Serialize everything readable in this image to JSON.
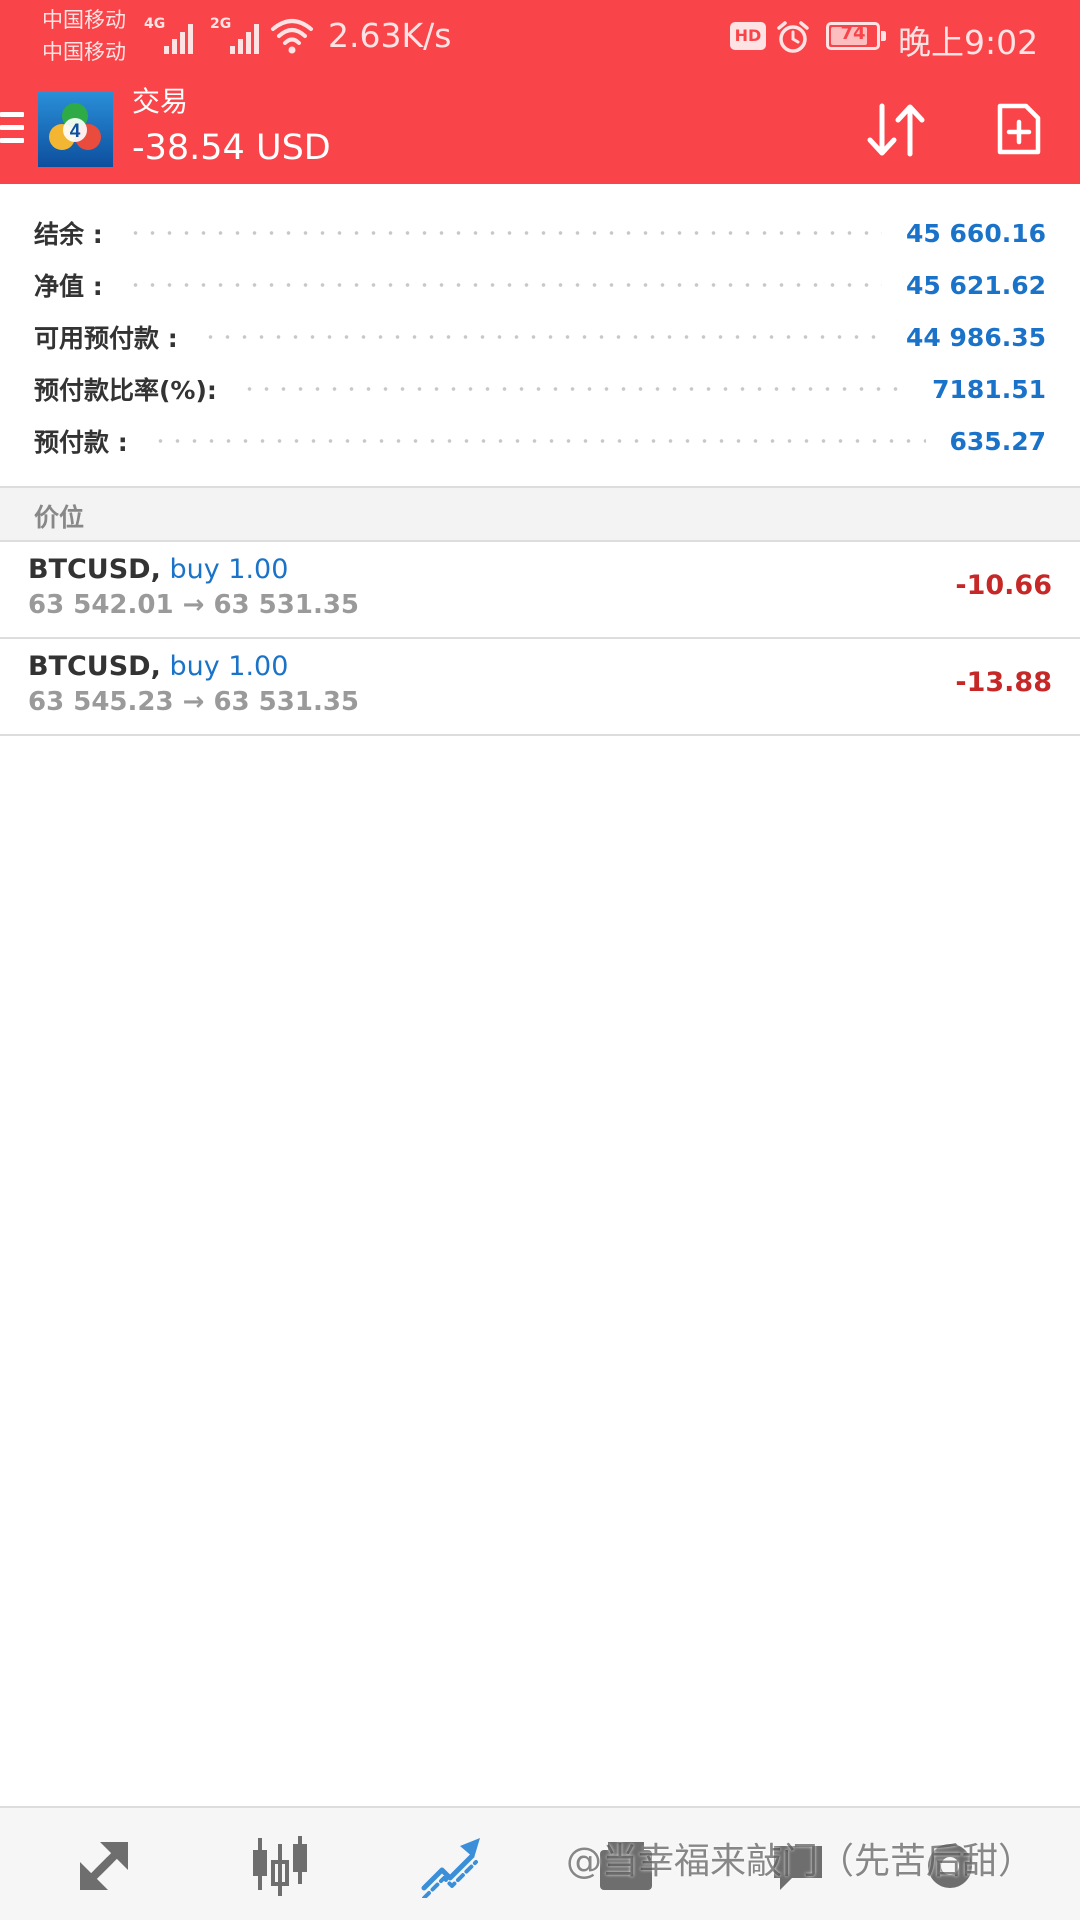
{
  "status_bar": {
    "carrier_1": "中国移动",
    "carrier_2": "中国移动",
    "signal_1_tag": "4G",
    "signal_2_tag": "2G",
    "net_speed": "2.63K/s",
    "hd_badge": "HD",
    "battery_level": "74",
    "time": "晚上9:02"
  },
  "app_bar": {
    "title": "交易",
    "subtitle": "-38.54 USD",
    "logo_icon": "metatrader-logo-icon",
    "sort_icon": "sort-arrows-icon",
    "new_order_icon": "new-document-icon",
    "menu_icon": "hamburger-menu-icon"
  },
  "summary": [
    {
      "label": "结余 :",
      "value": "45 660.16"
    },
    {
      "label": "净值 :",
      "value": "45 621.62"
    },
    {
      "label": "可用预付款 :",
      "value": "44 986.35"
    },
    {
      "label": "预付款比率(%):",
      "value": "7181.51"
    },
    {
      "label": "预付款 :",
      "value": "635.27"
    }
  ],
  "section": {
    "label": "价位"
  },
  "positions": [
    {
      "symbol": "BTCUSD",
      "separator": ",",
      "side": "buy 1.00",
      "prices": "63 542.01 → 63 531.35",
      "profit": "-10.66"
    },
    {
      "symbol": "BTCUSD",
      "separator": ",",
      "side": "buy 1.00",
      "prices": "63 545.23 → 63 531.35",
      "profit": "-13.88"
    }
  ],
  "bottom_nav": [
    {
      "name": "quotes",
      "icon": "quotes-arrows-icon"
    },
    {
      "name": "charts",
      "icon": "candlestick-chart-icon"
    },
    {
      "name": "trade",
      "icon": "trade-trend-icon",
      "active": true
    },
    {
      "name": "history",
      "icon": "history-icon"
    },
    {
      "name": "messages",
      "icon": "chat-bubble-icon"
    },
    {
      "name": "settings",
      "icon": "settings-icon"
    }
  ],
  "watermark": "@当幸福来敲门（先苦后甜）",
  "colors": {
    "header_bg": "#f94549",
    "value_blue": "#1a73c8",
    "loss_red": "#c62828",
    "active_nav": "#3b8fd9",
    "inactive_nav": "#6e6e6e"
  }
}
